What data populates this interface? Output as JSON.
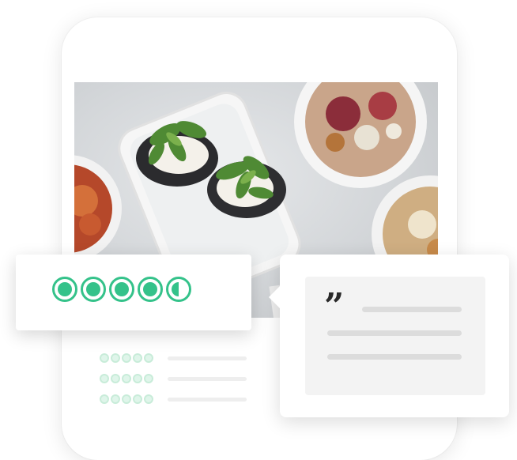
{
  "rating_card": {
    "rating": 4.5,
    "max": 5
  },
  "review_list": {
    "rows": [
      {
        "rating": 5
      },
      {
        "rating": 5
      },
      {
        "rating": 5
      }
    ]
  },
  "quote_card": {
    "icon": "quote-icon"
  },
  "colors": {
    "bubble_green": "#34c28a",
    "bubble_light": "#dff5ea",
    "placeholder_gray": "#dcdcdc"
  }
}
